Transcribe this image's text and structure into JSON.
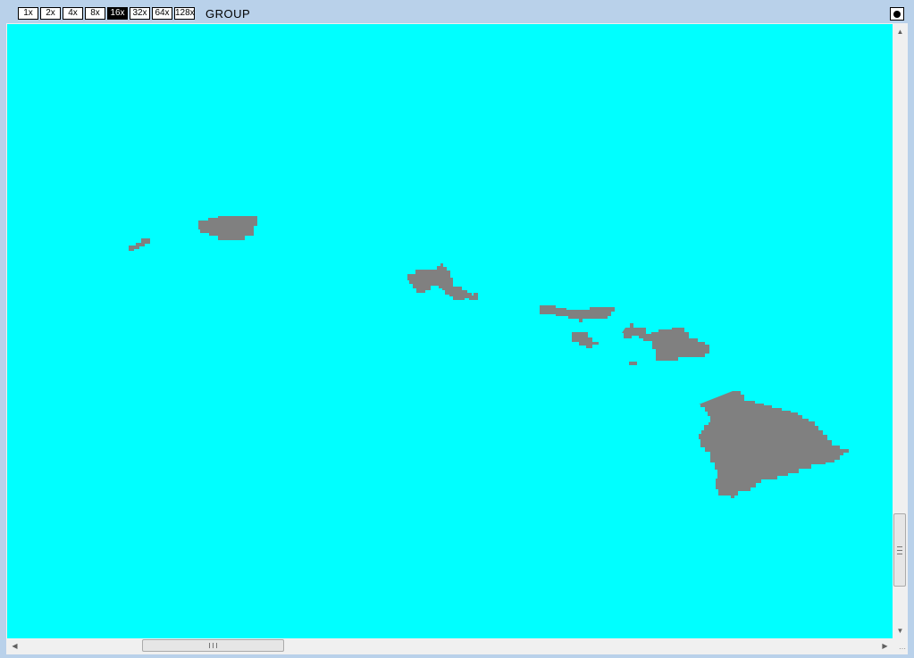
{
  "window": {
    "title": "GROUP",
    "zoom_levels": [
      "1x",
      "2x",
      "4x",
      "8x",
      "16x",
      "32x",
      "64x",
      "128x"
    ],
    "active_zoom": "16x"
  },
  "map": {
    "water_color": "#00ffff",
    "land_color": "#808080",
    "features": [
      "niihau",
      "kauai",
      "oahu",
      "molokai",
      "lanai",
      "maui",
      "kahoolawe",
      "hawaii"
    ]
  },
  "scrollbars": {
    "up_icon": "arrow-up-icon",
    "down_icon": "arrow-down-icon",
    "left_icon": "arrow-left-icon",
    "right_icon": "arrow-right-icon"
  }
}
